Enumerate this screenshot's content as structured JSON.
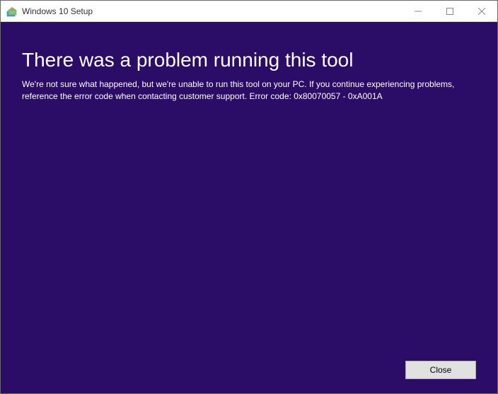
{
  "titlebar": {
    "title": "Windows 10 Setup"
  },
  "content": {
    "heading": "There was a problem running this tool",
    "body": "We're not sure what happened, but we're unable to run this tool on your PC. If you continue experiencing problems, reference the error code when contacting customer support. Error code: 0x80070057 - 0xA001A"
  },
  "actions": {
    "close_label": "Close"
  }
}
